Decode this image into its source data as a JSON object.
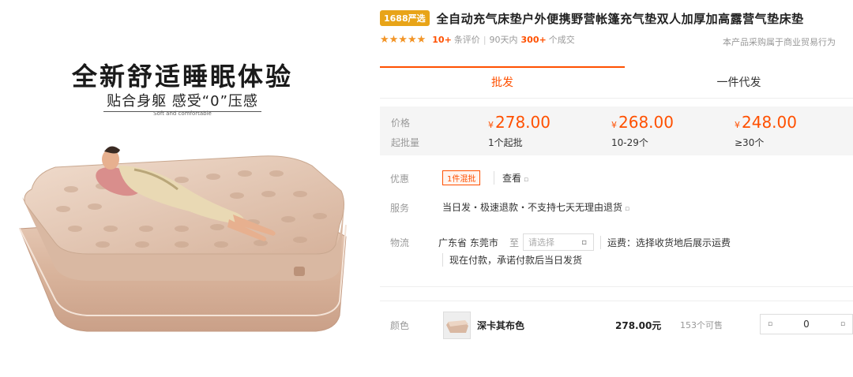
{
  "hero": {
    "title": "全新舒适睡眠体验",
    "subtitle": "贴合身躯 感受“0”压感",
    "small_text": "Soft and comfortable"
  },
  "product": {
    "badge": "1688严选",
    "title": "全自动充气床垫户外便携野营帐篷充气垫双人加厚加高露营气垫床垫",
    "stars": "★★★★★",
    "review_count": "10+",
    "review_label": "条评价",
    "sales_period": "90天内",
    "sales_count": "300+",
    "sales_label": "个成交",
    "trade_note": "本产品采购属于商业贸易行为"
  },
  "tabs": [
    {
      "label": "批发"
    },
    {
      "label": "一件代发"
    }
  ],
  "price_box": {
    "price_label": "价格",
    "min_label": "起批量",
    "currency": "¥",
    "tiers": [
      {
        "price": "278.00",
        "qty": "1个起批"
      },
      {
        "price": "268.00",
        "qty": "10-29个"
      },
      {
        "price": "248.00",
        "qty": "≥30个"
      }
    ]
  },
  "promo": {
    "label": "优惠",
    "tag": "1件混批",
    "view": "查看",
    "view_icon": "▫"
  },
  "service": {
    "label": "服务",
    "text": "当日发・极速退款・不支持七天无理由退货",
    "icon": "▫"
  },
  "logistics": {
    "label": "物流",
    "origin": "广东省 东莞市",
    "to": "至",
    "select_placeholder": "请选择",
    "select_icon": "▫",
    "fee": "运费：选择收货地后展示运费",
    "ship_note": "现在付款，承诺付款后当日发货"
  },
  "sku": {
    "label": "颜色",
    "name": "深卡其布色",
    "price": "278.00元",
    "stock": "153个可售",
    "quantity": "0",
    "minus_icon": "▫",
    "plus_icon": "▫"
  },
  "colors": {
    "accent": "#ff5000",
    "badge": "#e8a418",
    "stars": "#f29426"
  }
}
